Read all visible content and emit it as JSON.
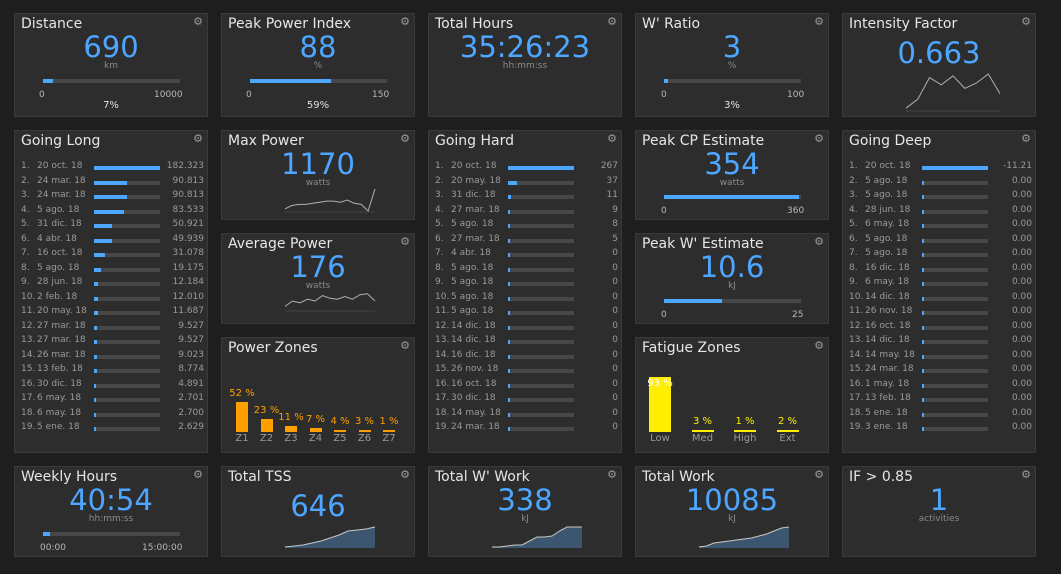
{
  "distance": {
    "title": "Distance",
    "value": "690",
    "unit": "km",
    "min": "0",
    "max": "10000",
    "pct": "7%",
    "fraction": 0.07
  },
  "peak_power_index": {
    "title": "Peak Power Index",
    "value": "88",
    "unit": "%",
    "min": "0",
    "max": "150",
    "pct": "59%",
    "fraction": 0.59
  },
  "total_hours": {
    "title": "Total Hours",
    "value": "35:26:23",
    "unit": "hh:mm:ss"
  },
  "w_ratio": {
    "title": "W' Ratio",
    "value": "3",
    "unit": "%",
    "min": "0",
    "max": "100",
    "pct": "3%",
    "fraction": 0.03
  },
  "intensity_factor": {
    "title": "Intensity Factor",
    "value": "0.663",
    "spark": [
      0.05,
      0.3,
      0.9,
      0.7,
      0.95,
      0.6,
      0.75,
      1.0,
      0.45
    ]
  },
  "going_long": {
    "title": "Going Long",
    "rows": [
      {
        "rank": "1.",
        "date": "20 oct. 18",
        "value": "182.323",
        "fraction": 1.0
      },
      {
        "rank": "2.",
        "date": "24 mar. 18",
        "value": "90.813",
        "fraction": 0.5
      },
      {
        "rank": "3.",
        "date": "24 mar. 18",
        "value": "90.813",
        "fraction": 0.5
      },
      {
        "rank": "4.",
        "date": "5 ago. 18",
        "value": "83.533",
        "fraction": 0.46
      },
      {
        "rank": "5.",
        "date": "31 dic. 18",
        "value": "50.921",
        "fraction": 0.28
      },
      {
        "rank": "6.",
        "date": "4 abr. 18",
        "value": "49.939",
        "fraction": 0.27
      },
      {
        "rank": "7.",
        "date": "16 oct. 18",
        "value": "31.078",
        "fraction": 0.17
      },
      {
        "rank": "8.",
        "date": "5 ago. 18",
        "value": "19.175",
        "fraction": 0.105
      },
      {
        "rank": "9.",
        "date": "28 jun. 18",
        "value": "12.184",
        "fraction": 0.067
      },
      {
        "rank": "10.",
        "date": "2 feb. 18",
        "value": "12.010",
        "fraction": 0.066
      },
      {
        "rank": "11.",
        "date": "20 may. 18",
        "value": "11.687",
        "fraction": 0.064
      },
      {
        "rank": "12.",
        "date": "27 mar. 18",
        "value": "9.527",
        "fraction": 0.052
      },
      {
        "rank": "13.",
        "date": "27 mar. 18",
        "value": "9.527",
        "fraction": 0.052
      },
      {
        "rank": "14.",
        "date": "26 mar. 18",
        "value": "9.023",
        "fraction": 0.049
      },
      {
        "rank": "15.",
        "date": "13 feb. 18",
        "value": "8.774",
        "fraction": 0.048
      },
      {
        "rank": "16.",
        "date": "30 dic. 18",
        "value": "4.891",
        "fraction": 0.027
      },
      {
        "rank": "17.",
        "date": "6 may. 18",
        "value": "2.701",
        "fraction": 0.015
      },
      {
        "rank": "18.",
        "date": "6 may. 18",
        "value": "2.700",
        "fraction": 0.015
      },
      {
        "rank": "19.",
        "date": "5 ene. 18",
        "value": "2.629",
        "fraction": 0.014
      }
    ]
  },
  "max_power": {
    "title": "Max Power",
    "value": "1170",
    "unit": "watts",
    "spark": [
      0.1,
      0.25,
      0.3,
      0.3,
      0.35,
      0.4,
      0.45,
      0.45,
      0.4,
      0.5,
      0.35,
      0.3,
      0.0,
      1.0
    ]
  },
  "going_hard": {
    "title": "Going Hard",
    "rows": [
      {
        "rank": "1.",
        "date": "20 oct. 18",
        "value": "267",
        "fraction": 1.0
      },
      {
        "rank": "2.",
        "date": "20 may. 18",
        "value": "37",
        "fraction": 0.139
      },
      {
        "rank": "3.",
        "date": "31 dic. 18",
        "value": "11",
        "fraction": 0.041
      },
      {
        "rank": "4.",
        "date": "27 mar. 18",
        "value": "9",
        "fraction": 0.034
      },
      {
        "rank": "5.",
        "date": "5 ago. 18",
        "value": "8",
        "fraction": 0.03
      },
      {
        "rank": "6.",
        "date": "27 mar. 18",
        "value": "5",
        "fraction": 0.019
      },
      {
        "rank": "7.",
        "date": "4 abr. 18",
        "value": "0",
        "fraction": 0.0
      },
      {
        "rank": "8.",
        "date": "5 ago. 18",
        "value": "0",
        "fraction": 0.0
      },
      {
        "rank": "9.",
        "date": "5 ago. 18",
        "value": "0",
        "fraction": 0.0
      },
      {
        "rank": "10.",
        "date": "5 ago. 18",
        "value": "0",
        "fraction": 0.0
      },
      {
        "rank": "11.",
        "date": "5 ago. 18",
        "value": "0",
        "fraction": 0.0
      },
      {
        "rank": "12.",
        "date": "14 dic. 18",
        "value": "0",
        "fraction": 0.0
      },
      {
        "rank": "13.",
        "date": "14 dic. 18",
        "value": "0",
        "fraction": 0.0
      },
      {
        "rank": "14.",
        "date": "16 dic. 18",
        "value": "0",
        "fraction": 0.0
      },
      {
        "rank": "15.",
        "date": "26 nov. 18",
        "value": "0",
        "fraction": 0.0
      },
      {
        "rank": "16.",
        "date": "16 oct. 18",
        "value": "0",
        "fraction": 0.0
      },
      {
        "rank": "17.",
        "date": "30 dic. 18",
        "value": "0",
        "fraction": 0.0
      },
      {
        "rank": "18.",
        "date": "14 may. 18",
        "value": "0",
        "fraction": 0.0
      },
      {
        "rank": "19.",
        "date": "24 mar. 18",
        "value": "0",
        "fraction": 0.0
      }
    ]
  },
  "peak_cp": {
    "title": "Peak CP Estimate",
    "value": "354",
    "unit": "watts",
    "min": "0",
    "max": "360",
    "fraction": 0.983
  },
  "going_deep": {
    "title": "Going Deep",
    "rows": [
      {
        "rank": "1.",
        "date": "20 oct. 18",
        "value": "-11.21",
        "fraction": 1.0
      },
      {
        "rank": "2.",
        "date": "5 ago. 18",
        "value": "0.00",
        "fraction": 0.0
      },
      {
        "rank": "3.",
        "date": "5 ago. 18",
        "value": "0.00",
        "fraction": 0.0
      },
      {
        "rank": "4.",
        "date": "28 jun. 18",
        "value": "0.00",
        "fraction": 0.0
      },
      {
        "rank": "5.",
        "date": "6 may. 18",
        "value": "0.00",
        "fraction": 0.0
      },
      {
        "rank": "6.",
        "date": "5 ago. 18",
        "value": "0.00",
        "fraction": 0.0
      },
      {
        "rank": "7.",
        "date": "5 ago. 18",
        "value": "0.00",
        "fraction": 0.0
      },
      {
        "rank": "8.",
        "date": "16 dic. 18",
        "value": "0.00",
        "fraction": 0.0
      },
      {
        "rank": "9.",
        "date": "6 may. 18",
        "value": "0.00",
        "fraction": 0.0
      },
      {
        "rank": "10.",
        "date": "14 dic. 18",
        "value": "0.00",
        "fraction": 0.0
      },
      {
        "rank": "11.",
        "date": "26 nov. 18",
        "value": "0.00",
        "fraction": 0.0
      },
      {
        "rank": "12.",
        "date": "16 oct. 18",
        "value": "0.00",
        "fraction": 0.0
      },
      {
        "rank": "13.",
        "date": "14 dic. 18",
        "value": "0.00",
        "fraction": 0.0
      },
      {
        "rank": "14.",
        "date": "14 may. 18",
        "value": "0.00",
        "fraction": 0.0
      },
      {
        "rank": "15.",
        "date": "24 mar. 18",
        "value": "0.00",
        "fraction": 0.0
      },
      {
        "rank": "16.",
        "date": "1 may. 18",
        "value": "0.00",
        "fraction": 0.0
      },
      {
        "rank": "17.",
        "date": "13 feb. 18",
        "value": "0.00",
        "fraction": 0.0
      },
      {
        "rank": "18.",
        "date": "5 ene. 18",
        "value": "0.00",
        "fraction": 0.0
      },
      {
        "rank": "19.",
        "date": "3 ene. 18",
        "value": "0.00",
        "fraction": 0.0
      }
    ]
  },
  "average_power": {
    "title": "Average Power",
    "value": "176",
    "unit": "watts",
    "spark": [
      0.2,
      0.5,
      0.4,
      0.6,
      0.5,
      0.8,
      0.65,
      0.6,
      0.75,
      0.6,
      0.85,
      0.9,
      0.5
    ]
  },
  "peak_w": {
    "title": "Peak W' Estimate",
    "value": "10.6",
    "unit": "kJ",
    "min": "0",
    "max": "25",
    "fraction": 0.424
  },
  "power_zones": {
    "title": "Power Zones",
    "zones": [
      {
        "label": "Z1",
        "pct": "52 %",
        "value": 52
      },
      {
        "label": "Z2",
        "pct": "23 %",
        "value": 23
      },
      {
        "label": "Z3",
        "pct": "11 %",
        "value": 11
      },
      {
        "label": "Z4",
        "pct": "7 %",
        "value": 7
      },
      {
        "label": "Z5",
        "pct": "4 %",
        "value": 4
      },
      {
        "label": "Z6",
        "pct": "3 %",
        "value": 3
      },
      {
        "label": "Z7",
        "pct": "1 %",
        "value": 1
      }
    ]
  },
  "fatigue_zones": {
    "title": "Fatigue Zones",
    "zones": [
      {
        "label": "Low",
        "pct": "93 %",
        "value": 93
      },
      {
        "label": "Med",
        "pct": "3 %",
        "value": 3
      },
      {
        "label": "High",
        "pct": "1 %",
        "value": 1
      },
      {
        "label": "Ext",
        "pct": "2 %",
        "value": 2
      }
    ]
  },
  "weekly_hours": {
    "title": "Weekly Hours",
    "value": "40:54",
    "unit": "hh:mm:ss",
    "min": "00:00",
    "max": "15:00:00",
    "fraction": 0.05
  },
  "total_tss": {
    "title": "Total TSS",
    "value": "646",
    "spark": [
      0.0,
      0.05,
      0.1,
      0.2,
      0.3,
      0.45,
      0.6,
      0.8,
      0.85,
      0.9,
      1.0
    ]
  },
  "total_w_work": {
    "title": "Total W' Work",
    "value": "338",
    "unit": "kJ",
    "spark": [
      0.0,
      0.0,
      0.05,
      0.1,
      0.1,
      0.3,
      0.5,
      0.5,
      0.55,
      0.8,
      1.0,
      1.0,
      1.0
    ]
  },
  "total_work": {
    "title": "Total Work",
    "value": "10085",
    "unit": "kJ",
    "spark": [
      0.0,
      0.05,
      0.2,
      0.25,
      0.3,
      0.35,
      0.4,
      0.45,
      0.55,
      0.65,
      0.8,
      0.95,
      1.0
    ]
  },
  "if_085": {
    "title": "IF > 0.85",
    "value": "1",
    "unit": "activities"
  },
  "colors": {
    "accent": "#4da6ff",
    "power_zone": "#ff9f00",
    "fatigue_zone": "#ffee00",
    "tile_bg": "#2d2d2d",
    "page_bg": "#1e1e1e"
  },
  "icons": {
    "settings": "gear-icon"
  }
}
